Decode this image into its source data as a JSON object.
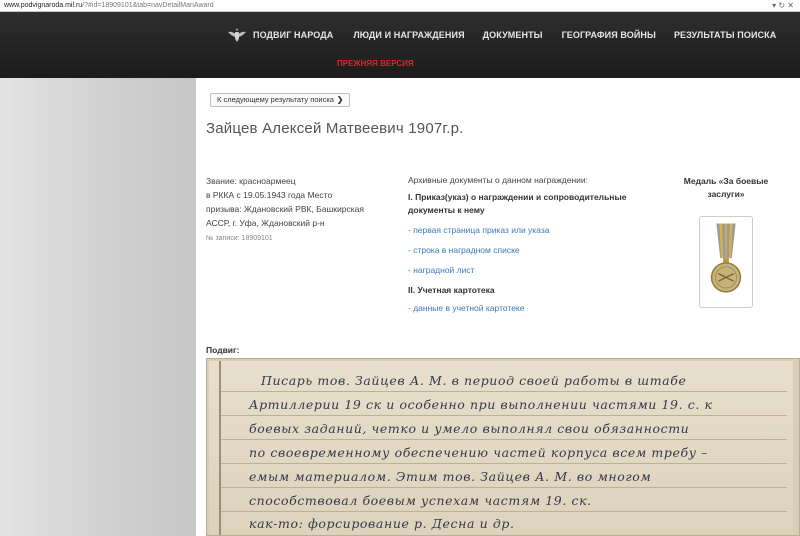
{
  "browser": {
    "url_domain": "www.podvignaroda.mil.ru",
    "url_path": "/?#id=18909101&tab=navDetailManAward"
  },
  "nav": {
    "items": [
      "ПОДВИГ НАРОДА",
      "ЛЮДИ И НАГРАЖДЕНИЯ",
      "ДОКУМЕНТЫ",
      "ГЕОГРАФИЯ ВОЙНЫ",
      "РЕЗУЛЬТАТЫ ПОИСКА"
    ],
    "prev_version": "ПРЕЖНЯЯ ВЕРСИЯ"
  },
  "main": {
    "next_result": "К следующему результату поиска",
    "person_name": "Зайцев Алексей Матвеевич 1907г.р.",
    "info_lines": [
      "Звание: красноармеец",
      "в РККА с 19.05.1943 года Место",
      "призыва: Ждановский РВК, Башкирская",
      "АССР, г. Уфа, Ждановский р-н"
    ],
    "record_no": "№ записи: 18909101",
    "archive": {
      "header": "Архивные документы о данном награждении:",
      "section1": "I. Приказ(указ) о награждении и сопроводительные документы к нему",
      "links1": [
        "- первая страница приказ или указа",
        "- строка в наградном списке",
        "- наградной лист"
      ],
      "section2": "II. Учетная картотека",
      "links2": [
        "- данные в учетной картотеке"
      ]
    },
    "medal_title": "Медаль «За боевые заслуги»",
    "feat_label": "Подвиг:",
    "handwriting": [
      "Писарь тов. Зайцев А. М. в период своей работы в штабе",
      "Артиллерии 19 ск и особенно при выполнении частями 19. с. к",
      "боевых заданий, четко и умело выполнял свои обязанности",
      "по своевременному обеспечению частей корпуса всем требу –",
      "емым материалом. Этим тов. Зайцев А. М. во многом",
      "способствовал боевым успехам частям 19. ск.",
      "как-то: форсирование р. Десна и др."
    ]
  }
}
